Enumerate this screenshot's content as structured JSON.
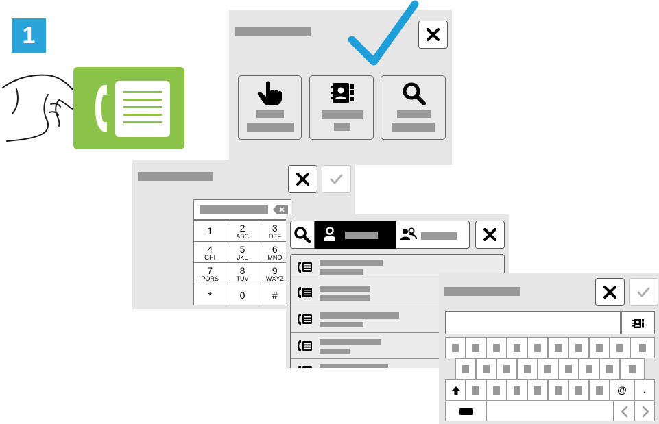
{
  "step": {
    "number": "1",
    "color": "#2aa3d8"
  },
  "colors": {
    "panel_bg": "#e6e6e6",
    "placeholder_bar": "#999999",
    "phone_app_green": "#8bc34a",
    "check_blue": "#1e9fd9"
  },
  "icons": [
    "pointing-hand-icon",
    "phone-app-icon",
    "checkmark-icon",
    "close-icon",
    "touch-icon",
    "address-book-icon",
    "search-icon",
    "backspace-icon",
    "user-icon",
    "users-icon",
    "phone-contact-icon",
    "shift-arrow-icon",
    "chevron-left-icon",
    "chevron-right-icon"
  ],
  "keypad": [
    [
      {
        "d": "1",
        "l": ""
      },
      {
        "d": "2",
        "l": "ABC"
      },
      {
        "d": "3",
        "l": "DEF"
      }
    ],
    [
      {
        "d": "4",
        "l": "GHI"
      },
      {
        "d": "5",
        "l": "JKL"
      },
      {
        "d": "6",
        "l": "MNO"
      }
    ],
    [
      {
        "d": "7",
        "l": "PQRS"
      },
      {
        "d": "8",
        "l": "TUV"
      },
      {
        "d": "9",
        "l": "WXYZ"
      }
    ],
    [
      {
        "d": "*",
        "l": ""
      },
      {
        "d": "0",
        "l": ""
      },
      {
        "d": "#",
        "l": ""
      }
    ]
  ],
  "keyboard": {
    "at_key": "@",
    "dot_key": "."
  }
}
